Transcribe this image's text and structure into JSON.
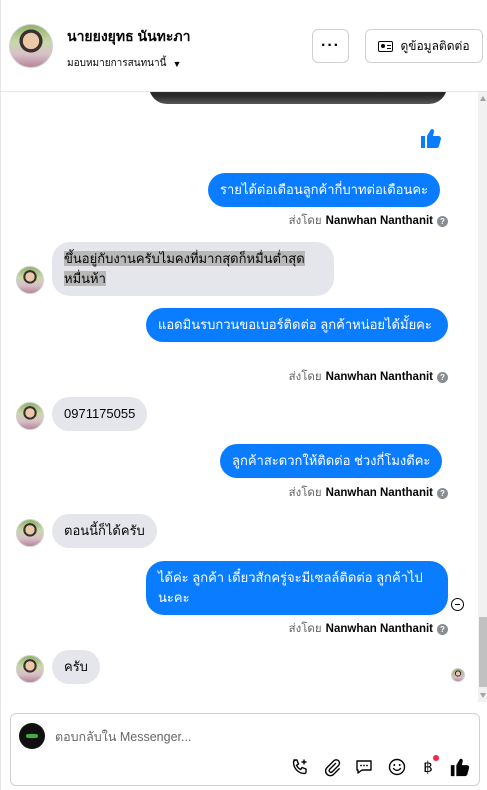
{
  "header": {
    "name": "นายยงยุทธ นันทะภา",
    "role": "มอบหมายการสนทนานี้",
    "contact_button": "ดูข้อมูลติดต่อ"
  },
  "messages": {
    "m1": "รายได้ต่อเดือนลูกค้ากี่บาทต่อเดือนคะ",
    "m2": "ขึ้นอยู่กับงานครับไมคงที่มากสุดก็หมื่นต่ำสุดหมื่นห้า",
    "m3": "แอดมินรบกวนขอเบอร์ติดต่อ ลูกค้าหน่อยได้มั้ยคะ",
    "m4": "0971175055",
    "m5": "ลูกค้าสะดวกให้ติดต่อ ช่วงกี่โมงดีคะ",
    "m6": "ตอนนี้ก็ได้ครับ",
    "m7": "ได้ค่ะ ลูกค้า เดี๋ยวสักครู่จะมีเซลล์ติดต่อ ลูกค้าไปนะคะ",
    "m8": "ครับ"
  },
  "sent_by": {
    "prefix": "ส่งโดย",
    "sender": "Nanwhan Nanthanit"
  },
  "composer": {
    "placeholder": "ตอบกลับใน Messenger..."
  },
  "icons": {
    "more": "more-icon",
    "contact": "contact-card-icon",
    "like": "thumbs-up-icon",
    "call": "call-add-icon",
    "attach": "paperclip-icon",
    "saved_replies": "speech-bubble-icon",
    "emoji": "smile-icon",
    "payment": "baht-icon"
  },
  "colors": {
    "accent": "#0a7cff",
    "incoming": "#e4e6eb",
    "notification": "#f02849"
  }
}
